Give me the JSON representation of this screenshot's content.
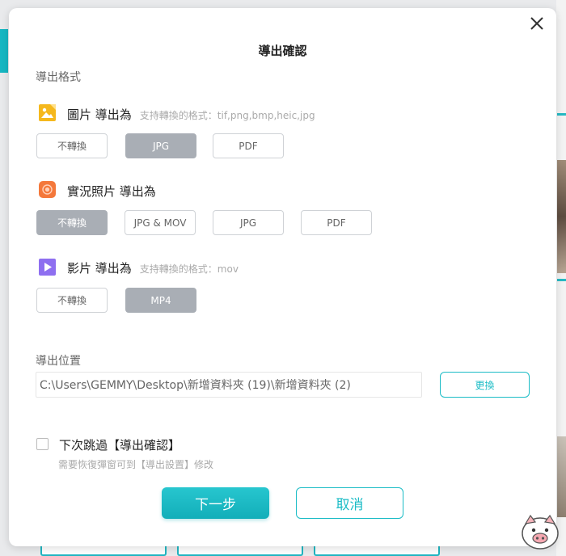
{
  "dialog": {
    "title": "導出確認",
    "format_section_label": "導出格式",
    "image_row": {
      "label": "圖片 導出為",
      "hint": "支持轉換的格式：tif,png,bmp,heic,jpg",
      "options": [
        "不轉換",
        "JPG",
        "PDF"
      ],
      "selected": "JPG"
    },
    "live_row": {
      "label": "實況照片 導出為",
      "options": [
        "不轉換",
        "JPG & MOV",
        "JPG",
        "PDF"
      ],
      "selected": "不轉換"
    },
    "video_row": {
      "label": "影片 導出為",
      "hint": "支持轉換的格式：mov",
      "options": [
        "不轉換",
        "MP4"
      ],
      "selected": "MP4"
    },
    "location_section_label": "導出位置",
    "path_value": "C:\\Users\\GEMMY\\Desktop\\新增資料夾 (19)\\新增資料夾 (2)",
    "change_label": "更換",
    "skip_label": "下次跳過【導出確認】",
    "skip_hint": "需要恢復彈窗可到【導出設置】修改",
    "next_label": "下一步",
    "cancel_label": "取消"
  },
  "colors": {
    "accent": "#1bbcc6",
    "selected_option": "#a9aeb5",
    "image_icon": "#f5b81d",
    "live_icon": "#f4783b",
    "video_icon": "#8e6ff0"
  },
  "icons": {
    "close": "close-icon",
    "image": "image-icon",
    "live": "live-photo-icon",
    "video": "video-play-icon"
  }
}
